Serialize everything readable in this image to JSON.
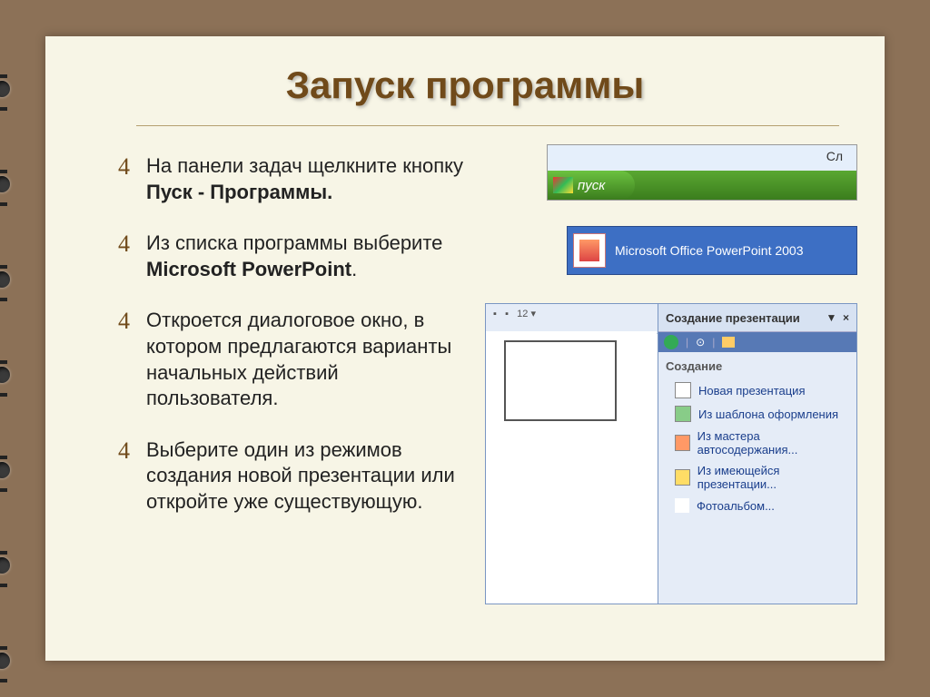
{
  "title": "Запуск программы",
  "bullets": [
    {
      "pre": "На панели задач щелкните кнопку ",
      "bold": "Пуск - Программы."
    },
    {
      "pre": "Из списка программы выберите ",
      "bold": "Microsoft PowerPoint",
      "post": "."
    },
    {
      "pre": "Откроется диалоговое окно, в котором предлагаются варианты начальных действий пользователя."
    },
    {
      "pre": "Выберите один из режимов создания новой презентации или откройте уже существующую."
    }
  ],
  "shot1": {
    "topright": "Сл",
    "start": "пуск"
  },
  "shot2": {
    "label": "Microsoft Office PowerPoint 2003"
  },
  "shot3": {
    "toolbar_zoom": "12",
    "pane_title": "Создание презентации",
    "section": "Создание",
    "items": [
      "Новая презентация",
      "Из шаблона оформления",
      "Из мастера автосодержания...",
      "Из имеющейся презентации...",
      "Фотоальбом..."
    ]
  }
}
